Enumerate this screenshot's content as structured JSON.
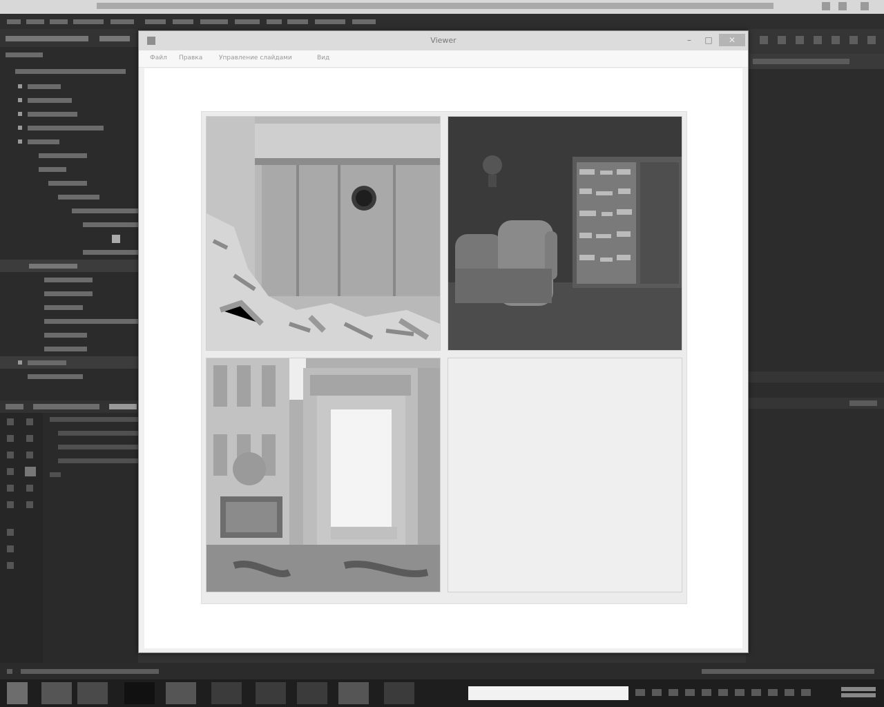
{
  "dialog": {
    "title": "Viewer",
    "menu": [
      "Файл",
      "Правка",
      "Управление слайдами",
      "Вид"
    ],
    "buttons": {
      "minimize": "–",
      "maximize": "□",
      "close": "✕"
    }
  },
  "images": [
    {
      "name": "Bunker door with rubble"
    },
    {
      "name": "Dark room with armchair and bookshelf"
    },
    {
      "name": "Ornate stone doorway"
    }
  ],
  "icons": {
    "app": "app-icon",
    "minimize": "minimize-icon",
    "maximize": "maximize-icon",
    "close": "close-icon"
  },
  "colors": {
    "background": "#3a3a3a",
    "dialog": "#f0f0f0",
    "canvas": "#ffffff",
    "taskbar": "#1e1e1e"
  }
}
